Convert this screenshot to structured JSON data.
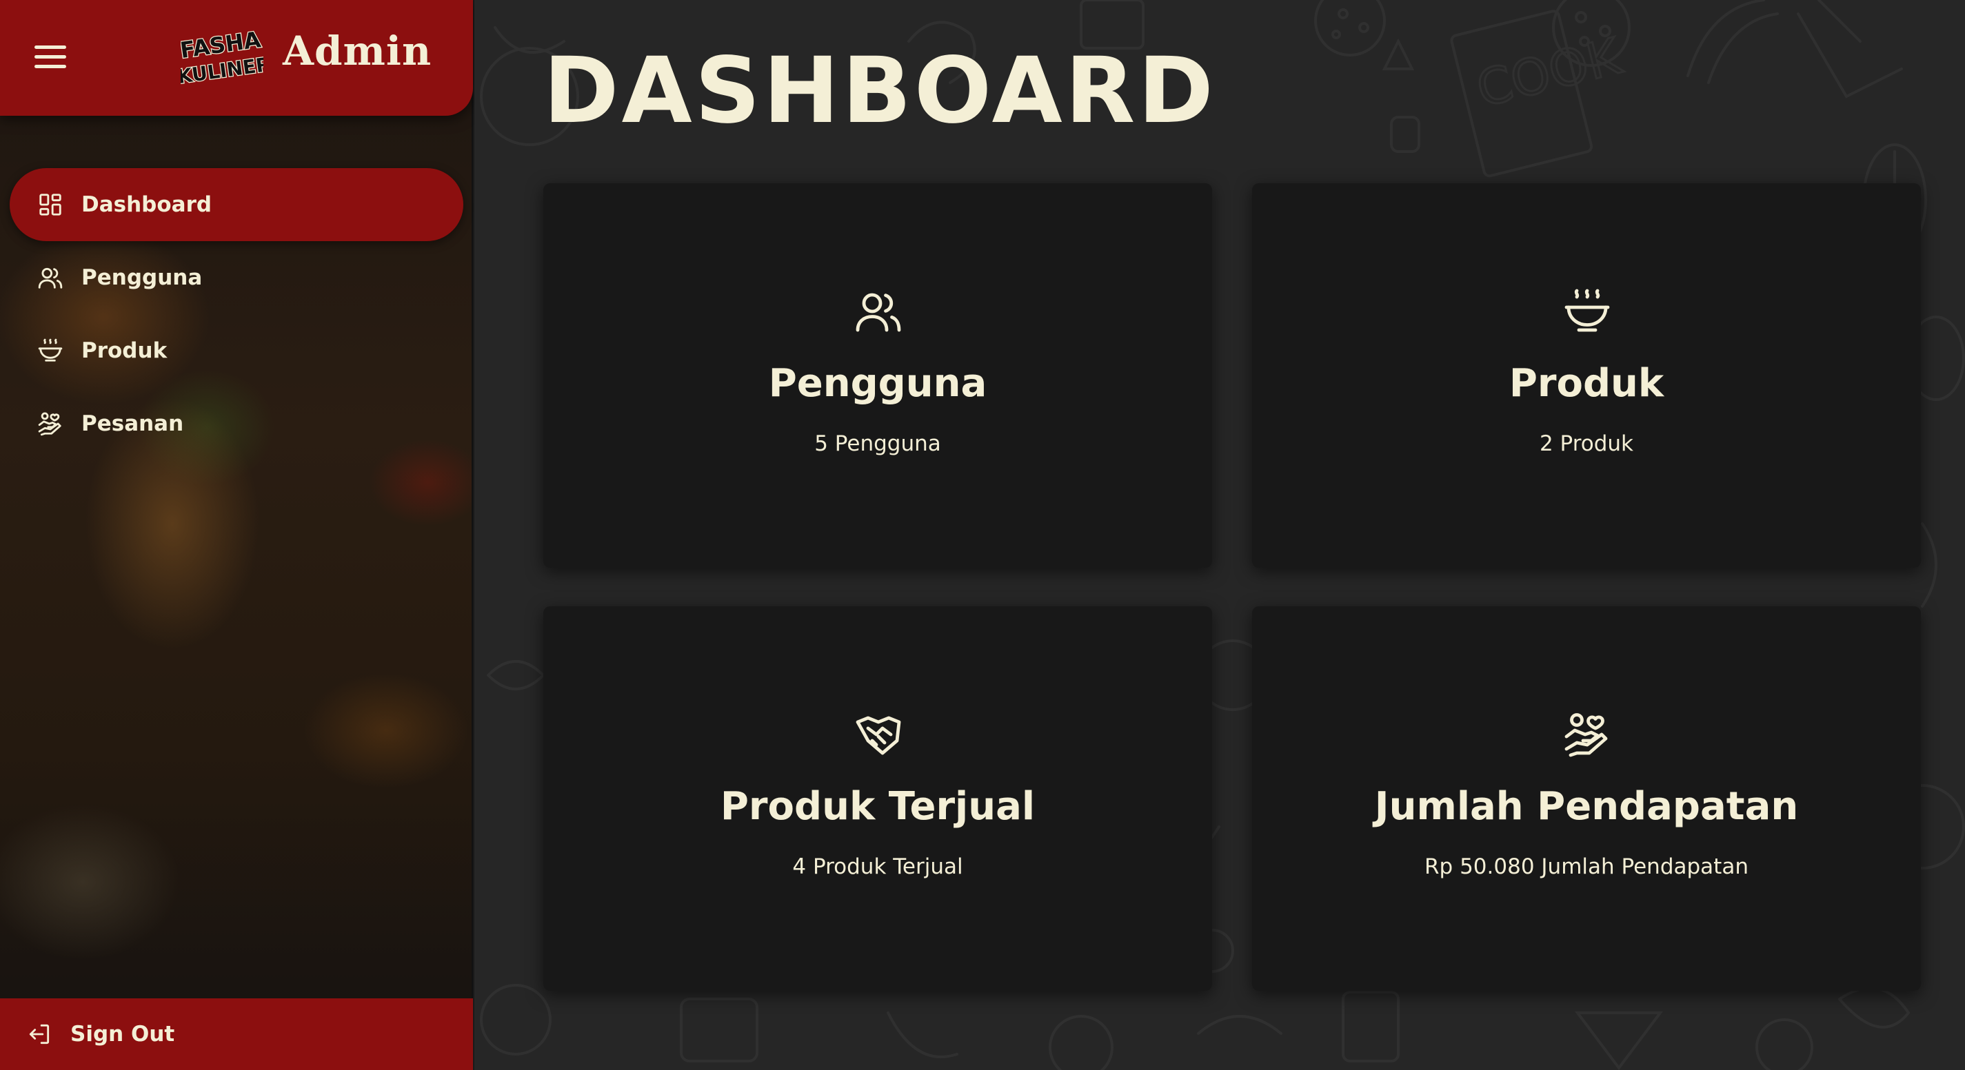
{
  "sidebar": {
    "brand": {
      "title": "Admin",
      "logo_text_line1": "FASHA",
      "logo_text_line2": "KULINER"
    },
    "menu_icon": "hamburger-menu-icon",
    "items": [
      {
        "label": "Dashboard",
        "icon": "dashboard-grid-icon",
        "active": true
      },
      {
        "label": "Pengguna",
        "icon": "users-icon",
        "active": false
      },
      {
        "label": "Produk",
        "icon": "bowl-icon",
        "active": false
      },
      {
        "label": "Pesanan",
        "icon": "hand-heart-icon",
        "active": false
      }
    ],
    "signout": {
      "label": "Sign Out",
      "icon": "sign-out-icon"
    }
  },
  "main": {
    "title": "DASHBOARD",
    "cards": [
      {
        "title": "Pengguna",
        "value": "5 Pengguna",
        "icon": "users-icon"
      },
      {
        "title": "Produk",
        "value": "2 Produk",
        "icon": "bowl-icon"
      },
      {
        "title": "Produk Terjual",
        "value": "4 Produk Terjual",
        "icon": "handshake-icon"
      },
      {
        "title": "Jumlah Pendapatan",
        "value": "Rp 50.080 Jumlah Pendapatan",
        "icon": "hand-heart-icon"
      }
    ]
  },
  "colors": {
    "accent_red": "#8c0f0f",
    "cream_text": "#f4efd6",
    "card_bg": "#181818",
    "main_bg": "#262626"
  }
}
